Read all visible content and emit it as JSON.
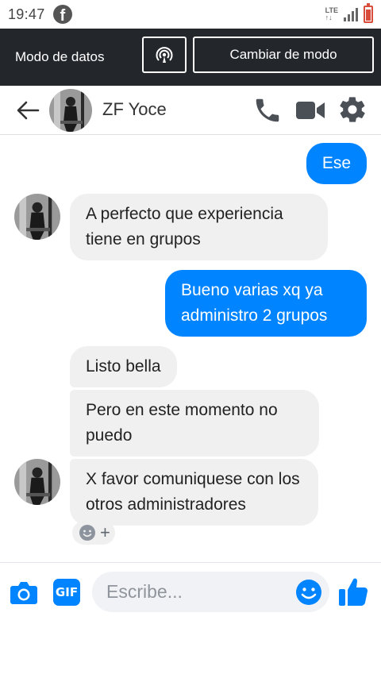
{
  "status_bar": {
    "time": "19:47",
    "network": "LTE"
  },
  "data_banner": {
    "label": "Modo de datos",
    "switch_button": "Cambiar de modo"
  },
  "header": {
    "contact_name": "ZF Yoce"
  },
  "messages": [
    {
      "direction": "out",
      "text": "Ese"
    },
    {
      "direction": "in",
      "text": "A perfecto que experiencia tiene en grupos"
    },
    {
      "direction": "out",
      "text": "Bueno varias xq ya administro 2 grupos"
    },
    {
      "direction": "in",
      "text": "Listo bella"
    },
    {
      "direction": "in",
      "text": "Pero en este momento no puedo"
    },
    {
      "direction": "in",
      "text": "X favor comuniquese con los otros administradores"
    }
  ],
  "composer": {
    "placeholder": "Escribe...",
    "gif_label": "GIF"
  },
  "icons": {
    "status_app": "facebook-icon",
    "hotspot": "hotspot-icon",
    "back": "arrow-left-icon",
    "call": "phone-icon",
    "video": "video-camera-icon",
    "settings": "gear-icon",
    "camera": "camera-icon",
    "emoji": "smiley-icon",
    "like": "thumbs-up-icon",
    "reaction": "smiley-icon"
  },
  "colors": {
    "accent": "#0084ff",
    "banner_bg": "#23272c",
    "incoming_bubble": "#f1f0f0"
  }
}
